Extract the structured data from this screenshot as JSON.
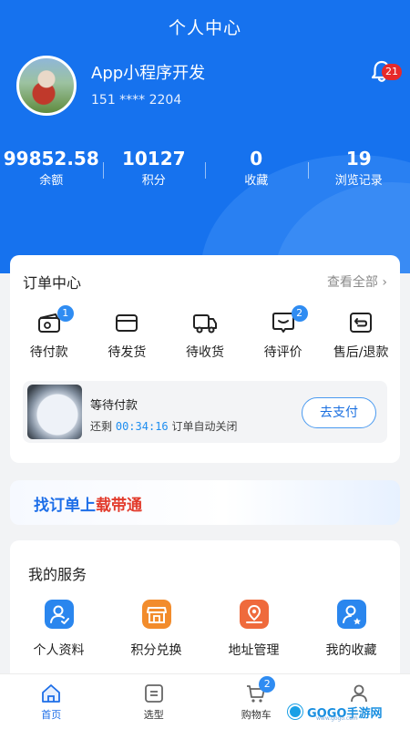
{
  "header": {
    "title": "个人中心"
  },
  "user": {
    "name": "App小程序开发",
    "phone": "151 **** 2204",
    "notifications": "21"
  },
  "stats": [
    {
      "value": "99852.58",
      "label": "余额"
    },
    {
      "value": "10127",
      "label": "积分"
    },
    {
      "value": "0",
      "label": "收藏"
    },
    {
      "value": "19",
      "label": "浏览记录"
    }
  ],
  "orders": {
    "title": "订单中心",
    "view_all": "查看全部",
    "items": [
      {
        "label": "待付款",
        "badge": "1"
      },
      {
        "label": "待发货",
        "badge": ""
      },
      {
        "label": "待收货",
        "badge": ""
      },
      {
        "label": "待评价",
        "badge": "2"
      },
      {
        "label": "售后/退款",
        "badge": ""
      }
    ],
    "pending": {
      "title": "等待付款",
      "prefix": "还剩",
      "time": "00:34:16",
      "suffix": "订单自动关闭",
      "pay_label": "去支付"
    }
  },
  "banner": {
    "part1": "找订单上",
    "part2": "载带通"
  },
  "services": {
    "title": "我的服务",
    "items": [
      {
        "label": "个人资料",
        "color": "#2a86ee"
      },
      {
        "label": "积分兑换",
        "color": "#f28c2c"
      },
      {
        "label": "地址管理",
        "color": "#ef6a3c"
      },
      {
        "label": "我的收藏",
        "color": "#2a86ee"
      }
    ]
  },
  "tabbar": {
    "items": [
      {
        "label": "首页"
      },
      {
        "label": "选型"
      },
      {
        "label": "购物车",
        "badge": "2"
      },
      {
        "label": "我的"
      }
    ]
  },
  "watermark": {
    "brand": "GOGO手游网",
    "sub": "www.gogo.com"
  },
  "colors": {
    "primary": "#1672ee",
    "accent": "#1d6ee8",
    "badge": "#e62a2a"
  }
}
